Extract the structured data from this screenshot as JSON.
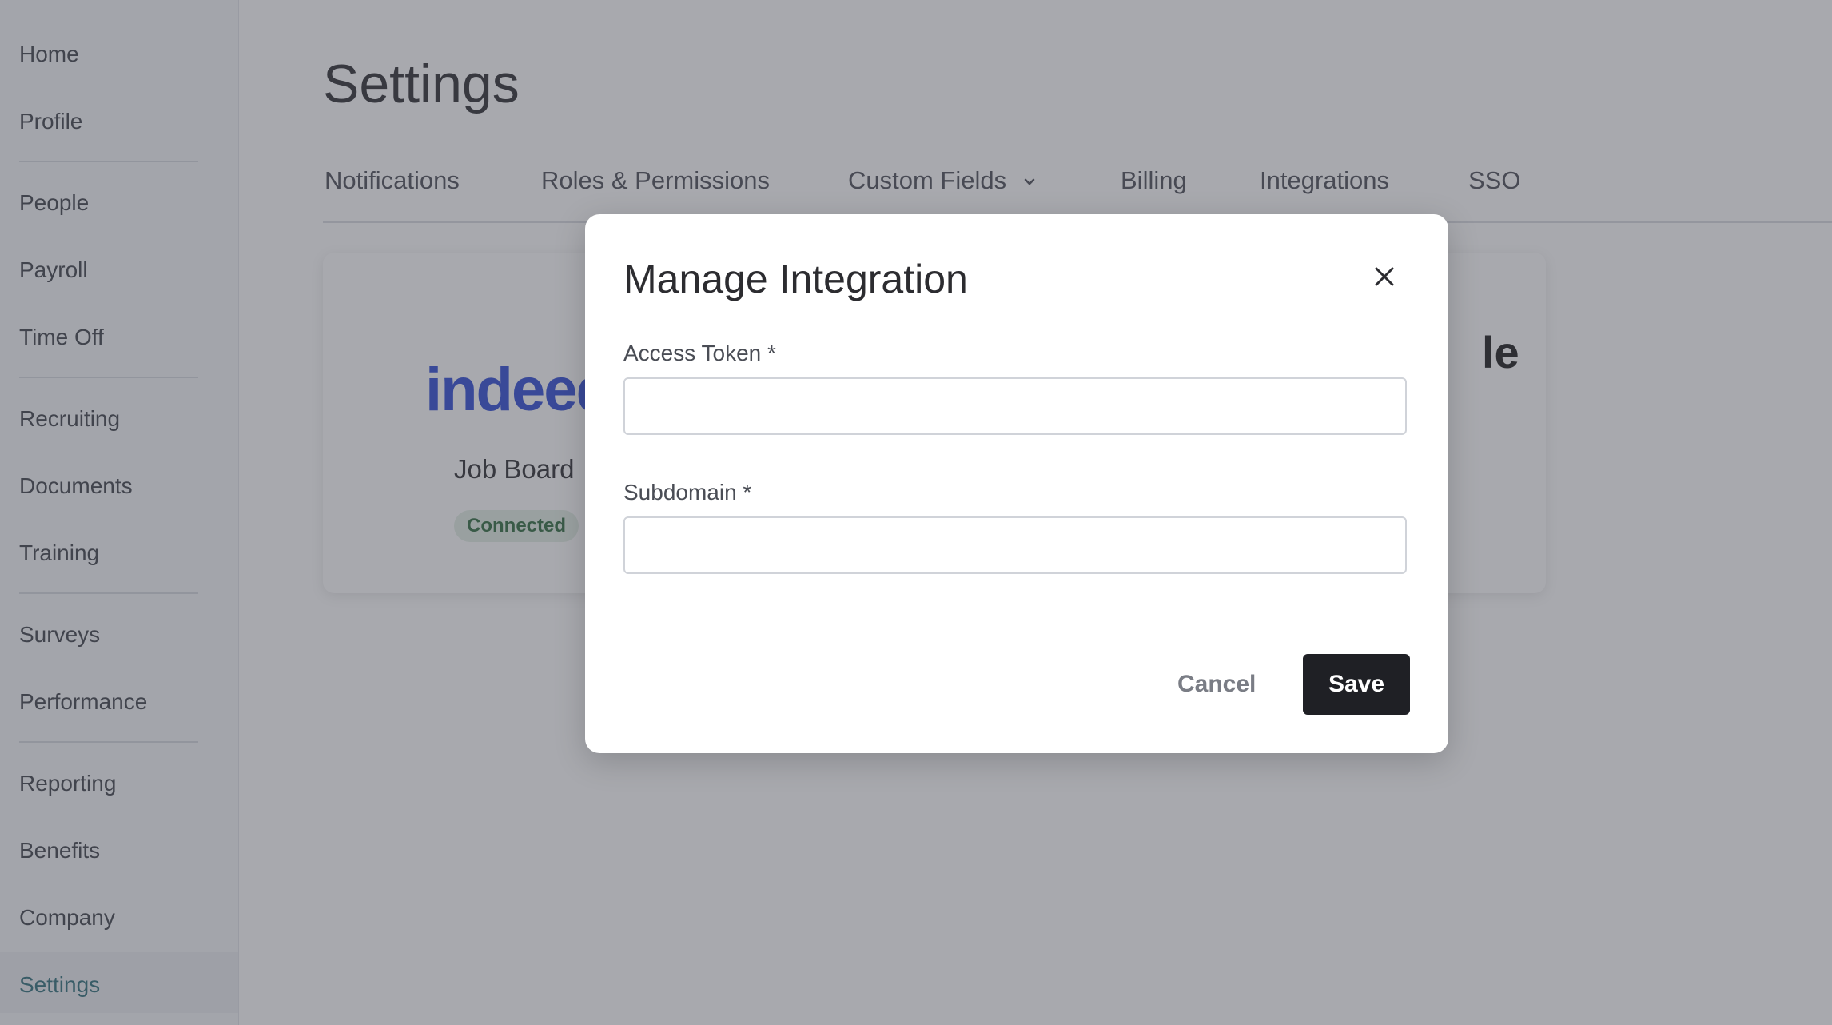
{
  "sidebar": {
    "items": [
      {
        "label": "Home"
      },
      {
        "label": "Profile"
      },
      {
        "label": "People"
      },
      {
        "label": "Payroll"
      },
      {
        "label": "Time Off"
      },
      {
        "label": "Recruiting"
      },
      {
        "label": "Documents"
      },
      {
        "label": "Training"
      },
      {
        "label": "Surveys"
      },
      {
        "label": "Performance"
      },
      {
        "label": "Reporting"
      },
      {
        "label": "Benefits"
      },
      {
        "label": "Company"
      },
      {
        "label": "Settings"
      }
    ],
    "active": "Settings"
  },
  "page": {
    "title": "Settings"
  },
  "tabs": [
    {
      "label": "Notifications"
    },
    {
      "label": "Roles & Permissions"
    },
    {
      "label": "Custom Fields"
    },
    {
      "label": "Billing"
    },
    {
      "label": "Integrations"
    },
    {
      "label": "SSO"
    }
  ],
  "integration_card": {
    "logo_text": "indeed",
    "label": "Job Board",
    "status": "Connected",
    "partial_logo_text": "le"
  },
  "modal": {
    "title": "Manage Integration",
    "fields": [
      {
        "label": "Access Token *",
        "value": ""
      },
      {
        "label": "Subdomain *",
        "value": ""
      }
    ],
    "cancel_label": "Cancel",
    "save_label": "Save"
  },
  "colors": {
    "accent": "#2f6f7a",
    "primary_button": "#1f2025",
    "badge_bg": "#e2efe4",
    "badge_text": "#2f6a3e",
    "indeed_blue": "#2f4bd6"
  }
}
